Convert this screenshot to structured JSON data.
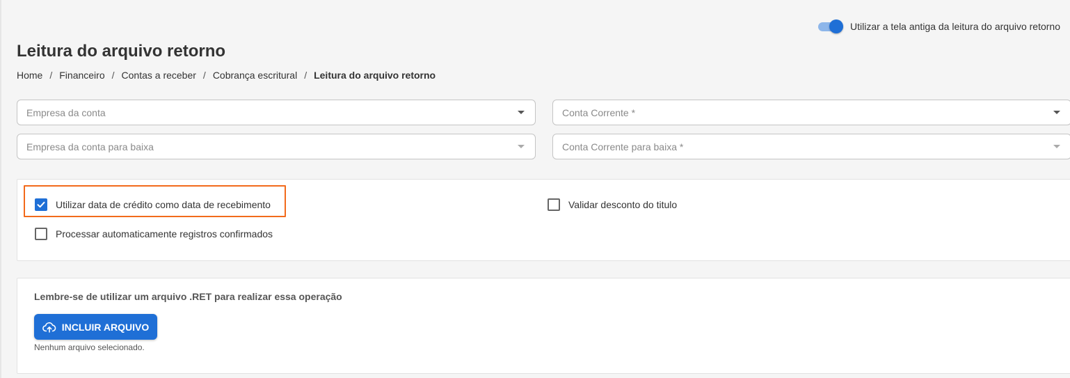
{
  "toggle": {
    "label": "Utilizar a tela antiga da leitura do arquivo retorno",
    "on": true
  },
  "page": {
    "title": "Leitura do arquivo retorno"
  },
  "breadcrumb": {
    "items": [
      "Home",
      "Financeiro",
      "Contas a receber",
      "Cobrança escritural"
    ],
    "current": "Leitura do arquivo retorno",
    "separator": "/"
  },
  "filters": {
    "empresa_conta": {
      "placeholder": "Empresa da conta"
    },
    "conta_corrente": {
      "placeholder": "Conta Corrente *"
    },
    "empresa_baixa": {
      "placeholder": "Empresa da conta para baixa"
    },
    "conta_baixa": {
      "placeholder": "Conta Corrente para baixa *"
    }
  },
  "options": {
    "data_credito": {
      "label": "Utilizar data de crédito como data de recebimento",
      "checked": true
    },
    "validar_desconto": {
      "label": "Validar desconto do titulo",
      "checked": false
    },
    "processar_auto": {
      "label": "Processar automaticamente registros confirmados",
      "checked": false
    }
  },
  "upload": {
    "hint": "Lembre-se de utilizar um arquivo .RET para realizar essa operação",
    "button_label": "INCLUIR ARQUIVO",
    "button_icon": "cloud-upload-icon",
    "status": "Nenhum arquivo selecionado."
  },
  "colors": {
    "primary": "#1f6fd6",
    "highlight": "#f26a1b",
    "background": "#f5f5f5"
  }
}
